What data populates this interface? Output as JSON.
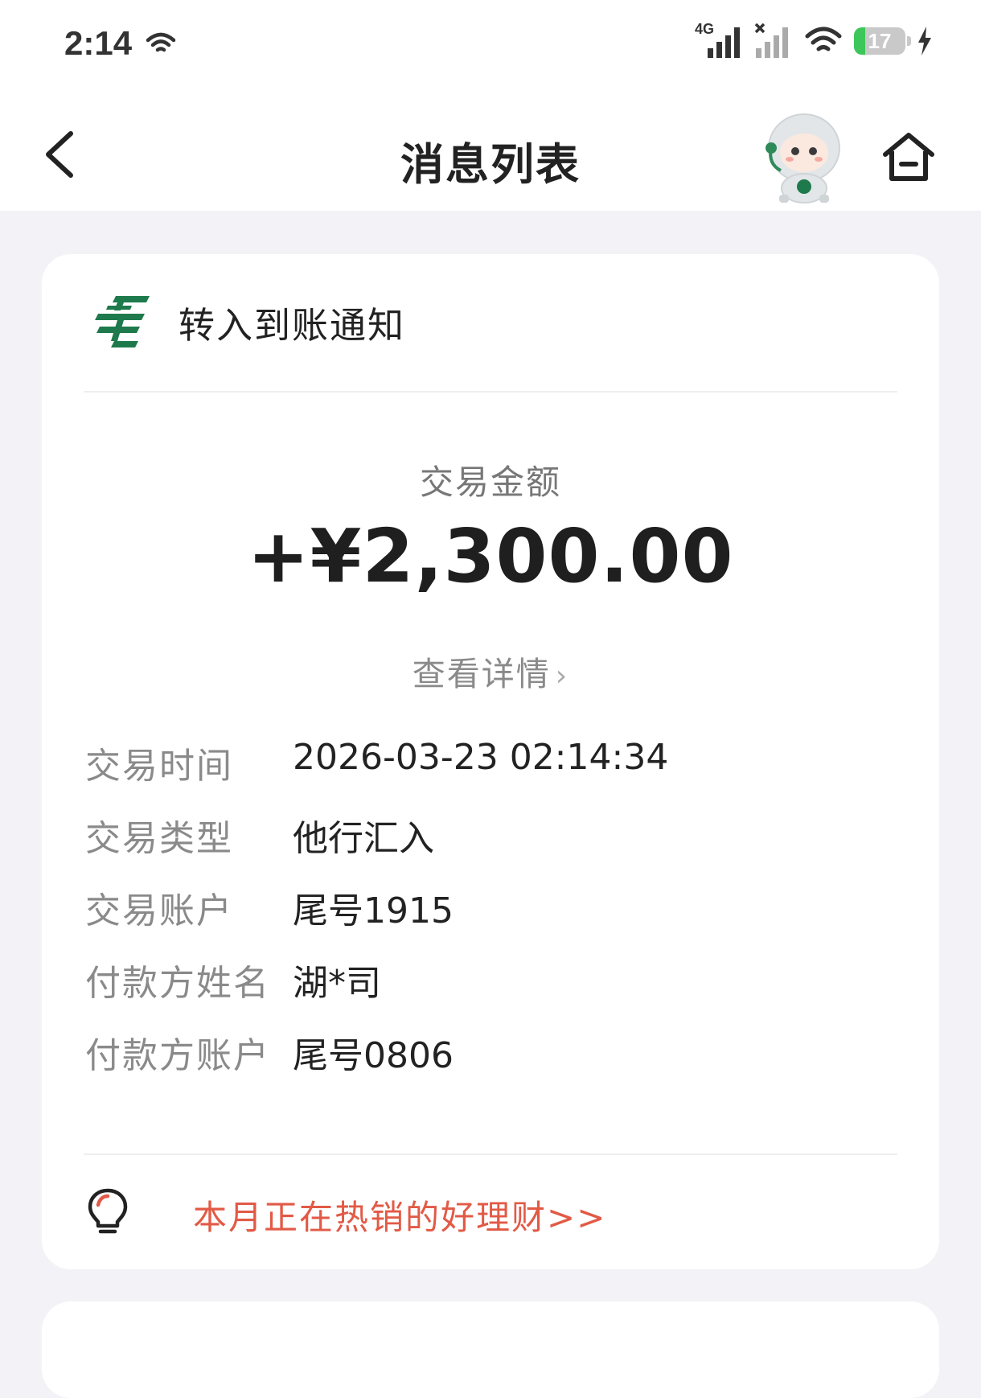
{
  "status_bar": {
    "time": "2:14",
    "network": "4G",
    "battery": "17"
  },
  "nav": {
    "title": "消息列表"
  },
  "notification": {
    "title": "转入到账通知",
    "amount_label": "交易金额",
    "amount": "+¥2,300.00",
    "detail_link": "查看详情",
    "details": [
      {
        "key": "交易时间",
        "value": "2026-03-23 02:14:34"
      },
      {
        "key": "交易类型",
        "value": "他行汇入"
      },
      {
        "key": "交易账户",
        "value": "尾号1915"
      },
      {
        "key": "付款方姓名",
        "value": "湖*司"
      },
      {
        "key": "付款方账户",
        "value": "尾号0806"
      }
    ],
    "promo_text": "本月正在热销的好理财>>"
  },
  "colors": {
    "brand_green": "#1e7a4c",
    "promo_red": "#e25a46",
    "battery_green": "#3dc75a"
  },
  "icons": {
    "back": "chevron-left-icon",
    "home": "home-icon",
    "assistant": "robot-assistant-icon",
    "logo": "postal-bank-logo-icon",
    "tip": "lightbulb-icon"
  }
}
